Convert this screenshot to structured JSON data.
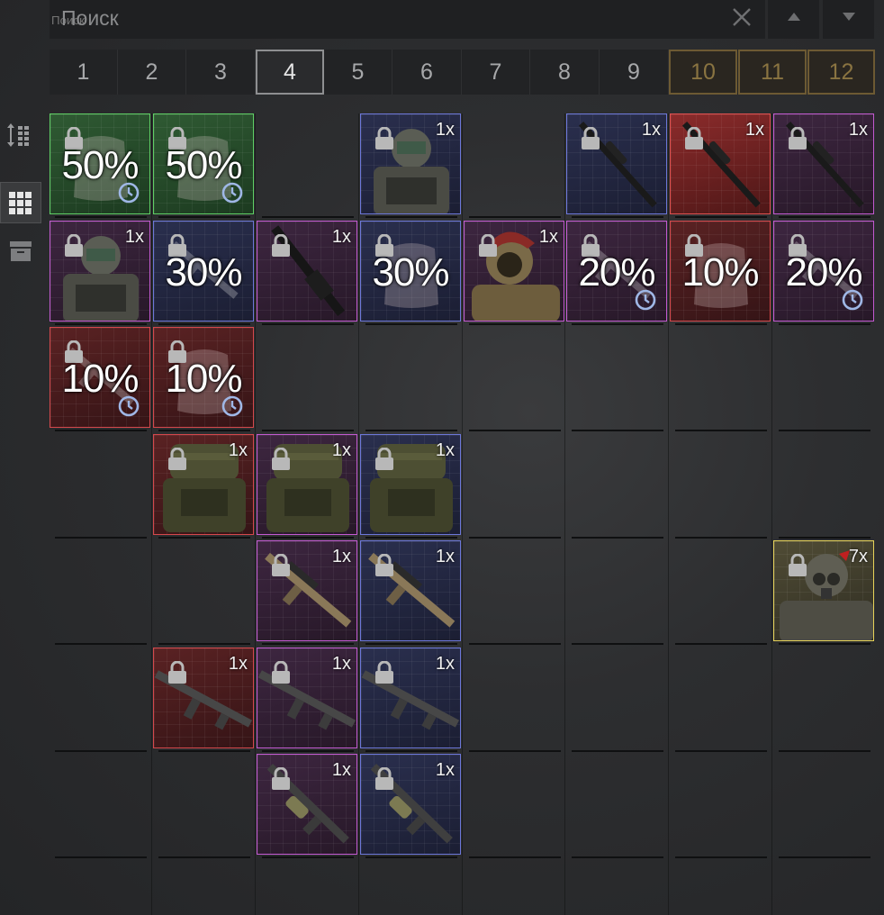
{
  "search": {
    "placeholder": "Поиск"
  },
  "pages": [
    "1",
    "2",
    "3",
    "4",
    "5",
    "6",
    "7",
    "8",
    "9",
    "10",
    "11",
    "12"
  ],
  "active_page": "4",
  "toolbar": {
    "icons": [
      "sort-icon",
      "grid-view-icon",
      "archive-icon"
    ]
  },
  "grid": {
    "cells": [
      {
        "row": 0,
        "col": 0,
        "rarity": "green",
        "kind": "percent",
        "pct": "50%",
        "timer": true,
        "item": "armor-vest"
      },
      {
        "row": 0,
        "col": 1,
        "rarity": "green",
        "kind": "percent",
        "pct": "50%",
        "timer": true,
        "item": "armor-vest"
      },
      {
        "row": 0,
        "col": 3,
        "rarity": "blue",
        "kind": "item",
        "count": "1x",
        "item": "exoskeleton"
      },
      {
        "row": 0,
        "col": 5,
        "rarity": "blue",
        "kind": "item",
        "count": "1x",
        "item": "sniper-rifle"
      },
      {
        "row": 0,
        "col": 6,
        "rarity": "redbright",
        "kind": "item",
        "count": "1x",
        "item": "sniper-rifle"
      },
      {
        "row": 0,
        "col": 7,
        "rarity": "purple",
        "kind": "item",
        "count": "1x",
        "item": "sniper-rifle"
      },
      {
        "row": 1,
        "col": 0,
        "rarity": "purple",
        "kind": "item",
        "count": "1x",
        "item": "exoskeleton"
      },
      {
        "row": 1,
        "col": 1,
        "rarity": "blue",
        "kind": "percent",
        "pct": "30%",
        "timer": false,
        "item": "rifle"
      },
      {
        "row": 1,
        "col": 2,
        "rarity": "purple",
        "kind": "item",
        "count": "1x",
        "item": "rifle-barrel"
      },
      {
        "row": 1,
        "col": 3,
        "rarity": "blue",
        "kind": "percent",
        "pct": "30%",
        "timer": false,
        "item": "armor-vest"
      },
      {
        "row": 1,
        "col": 4,
        "rarity": "purple",
        "kind": "item",
        "count": "1x",
        "item": "helmet-armor"
      },
      {
        "row": 1,
        "col": 5,
        "rarity": "purple",
        "kind": "percent",
        "pct": "20%",
        "timer": true,
        "item": "rifle"
      },
      {
        "row": 1,
        "col": 6,
        "rarity": "red",
        "kind": "percent",
        "pct": "10%",
        "timer": false,
        "item": "armor-vest"
      },
      {
        "row": 1,
        "col": 7,
        "rarity": "purple",
        "kind": "percent",
        "pct": "20%",
        "timer": true,
        "item": "rifle"
      },
      {
        "row": 2,
        "col": 0,
        "rarity": "red",
        "kind": "percent",
        "pct": "10%",
        "timer": true,
        "item": "rifle"
      },
      {
        "row": 2,
        "col": 1,
        "rarity": "red",
        "kind": "percent",
        "pct": "10%",
        "timer": true,
        "item": "armor-vest"
      },
      {
        "row": 3,
        "col": 1,
        "rarity": "red",
        "kind": "item",
        "count": "1x",
        "item": "ghillie-armor"
      },
      {
        "row": 3,
        "col": 2,
        "rarity": "purple",
        "kind": "item",
        "count": "1x",
        "item": "ghillie-armor"
      },
      {
        "row": 3,
        "col": 3,
        "rarity": "blue",
        "kind": "item",
        "count": "1x",
        "item": "ghillie-armor"
      },
      {
        "row": 4,
        "col": 2,
        "rarity": "purple",
        "kind": "item",
        "count": "1x",
        "item": "assault-rifle"
      },
      {
        "row": 4,
        "col": 3,
        "rarity": "blue",
        "kind": "item",
        "count": "1x",
        "item": "assault-rifle"
      },
      {
        "row": 4,
        "col": 7,
        "rarity": "yellow",
        "kind": "item",
        "count": "7x",
        "item": "gas-mask-armor"
      },
      {
        "row": 5,
        "col": 1,
        "rarity": "red",
        "kind": "item",
        "count": "1x",
        "item": "carbine"
      },
      {
        "row": 5,
        "col": 2,
        "rarity": "purple",
        "kind": "item",
        "count": "1x",
        "item": "carbine"
      },
      {
        "row": 5,
        "col": 3,
        "rarity": "blue",
        "kind": "item",
        "count": "1x",
        "item": "carbine"
      },
      {
        "row": 6,
        "col": 2,
        "rarity": "purple",
        "kind": "item",
        "count": "1x",
        "item": "grenade-launcher-rifle"
      },
      {
        "row": 6,
        "col": 3,
        "rarity": "blue",
        "kind": "item",
        "count": "1x",
        "item": "grenade-launcher-rifle"
      }
    ]
  },
  "colors": {
    "green": "#5fcf65",
    "blue": "#6c77d9",
    "purple": "#c35ad1",
    "red": "#d5484c",
    "yellow": "#e7d35a",
    "gold": "#8a7441"
  }
}
